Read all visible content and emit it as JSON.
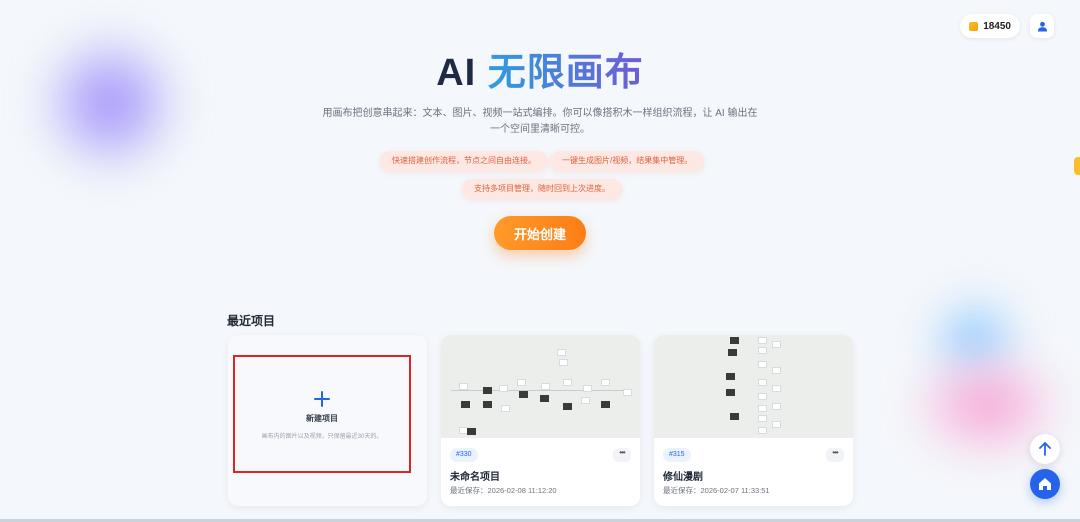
{
  "header": {
    "credits": "18450",
    "icons": [
      "coin-icon",
      "user-icon"
    ]
  },
  "hero": {
    "title_part1": "AI",
    "title_part2": "无限画布",
    "description": "用画布把创意串起来：文本、图片、视频一站式编排。你可以像搭积木一样组织流程，让 AI 输出在一个空间里清晰可控。",
    "features": [
      "快速搭建创作流程，节点之间自由连接。",
      "一键生成图片/视频，结果集中管理。",
      "支持多项目管理，随时回到上次进度。"
    ],
    "start_button": "开始创建"
  },
  "recent": {
    "title": "最近项目",
    "new_project": {
      "label": "新建项目",
      "hint": "画布内的图片以及视频，只保留最近30天的。"
    },
    "projects": [
      {
        "id": "#330",
        "name": "未命名项目",
        "saved": "最近保存：2026-02-08 11:12:20"
      },
      {
        "id": "#315",
        "name": "修仙漫剧",
        "saved": "最近保存：2026-02-07 11:33:51"
      }
    ]
  },
  "floating": {
    "icons": [
      "arrow-up-icon",
      "home-icon"
    ]
  },
  "colors": {
    "accent_blue": "#2563eb",
    "start_orange": "#fb7e16",
    "tag_text": "#e0603a",
    "highlight_red": "#e02424"
  }
}
